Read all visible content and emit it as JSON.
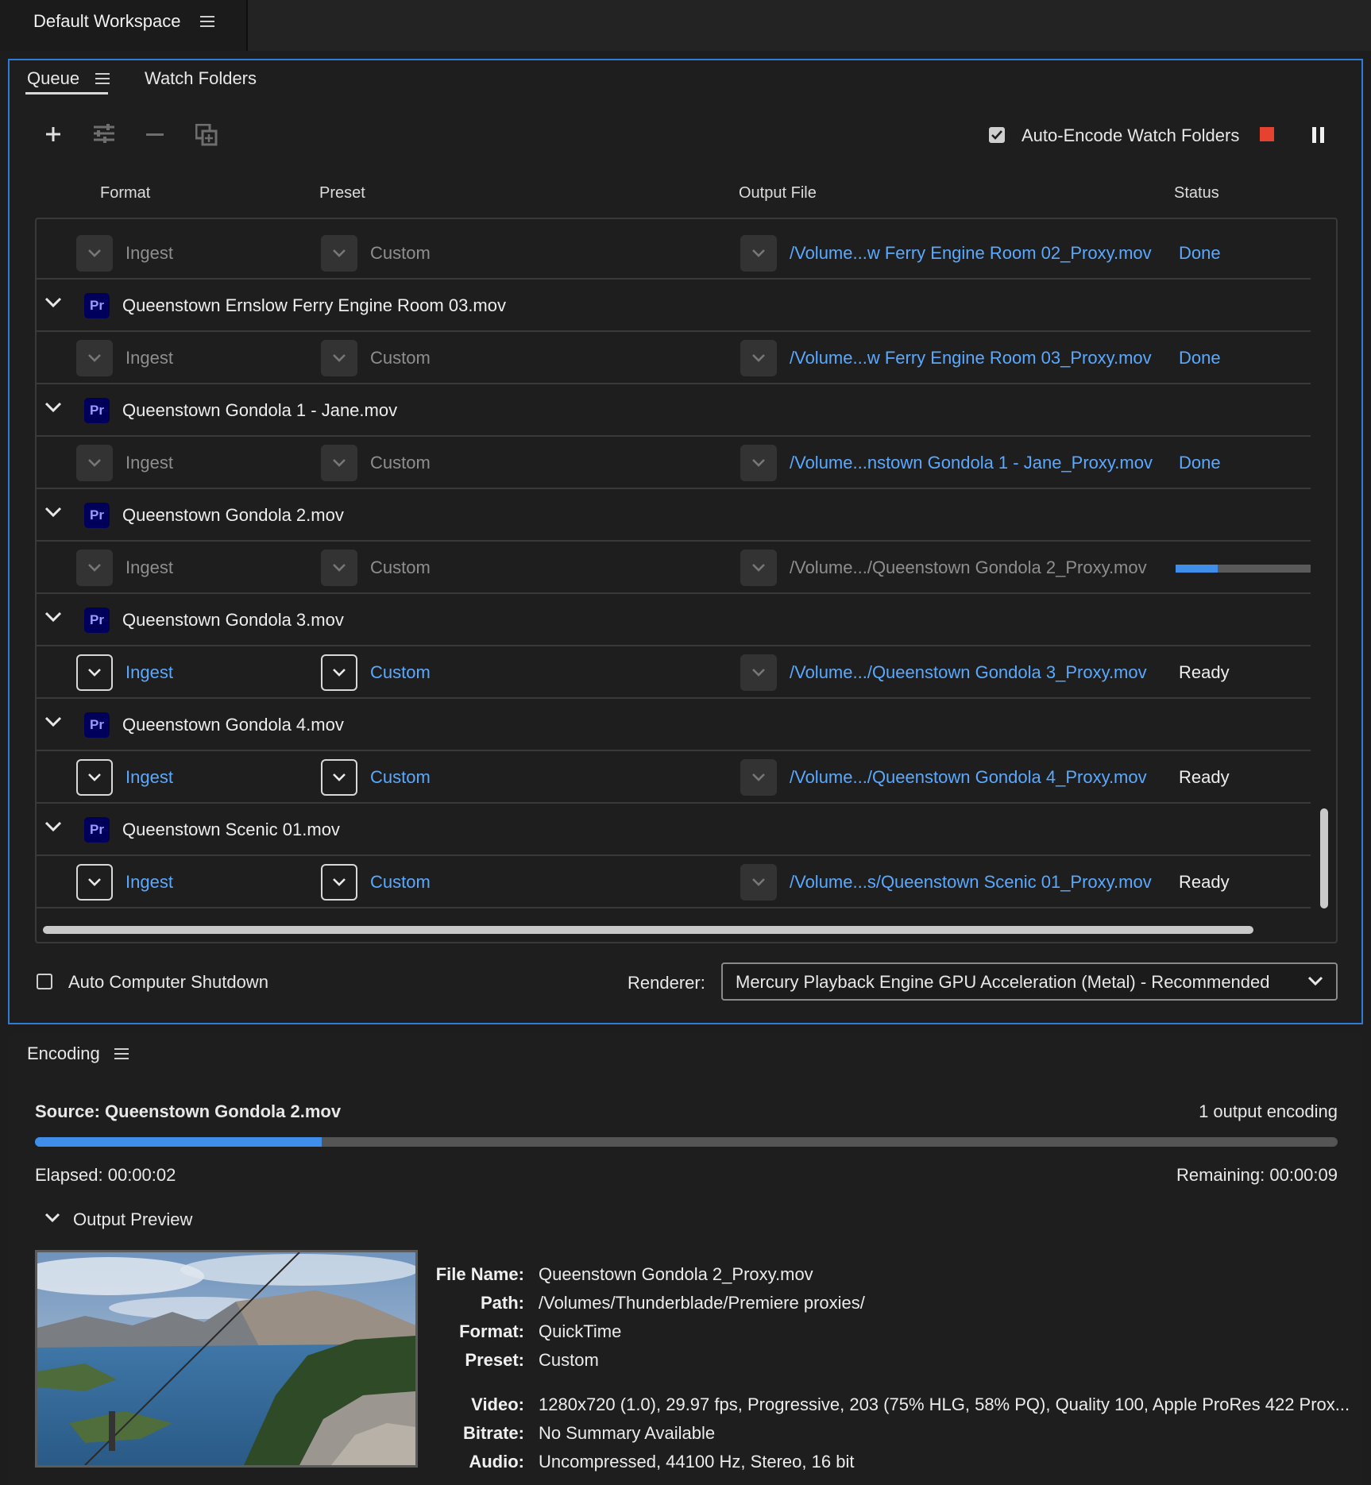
{
  "workspace": {
    "title": "Default Workspace"
  },
  "queue": {
    "tabs": [
      {
        "label": "Queue"
      },
      {
        "label": "Watch Folders"
      }
    ],
    "auto_encode": {
      "label": "Auto-Encode Watch Folders",
      "checked": true
    },
    "columns": {
      "format": "Format",
      "preset": "Preset",
      "output": "Output File",
      "status": "Status"
    },
    "rows": [
      {
        "kind": "output",
        "format": "Ingest",
        "preset": "Custom",
        "output": "/Volume...w Ferry Engine Room 02_Proxy.mov",
        "status": "Done",
        "editable": false
      },
      {
        "kind": "source",
        "name": "Queenstown Ernslow Ferry Engine Room 03.mov",
        "badge": "Pr"
      },
      {
        "kind": "output",
        "format": "Ingest",
        "preset": "Custom",
        "output": "/Volume...w Ferry Engine Room 03_Proxy.mov",
        "status": "Done",
        "editable": false
      },
      {
        "kind": "source",
        "name": "Queenstown Gondola 1 - Jane.mov",
        "badge": "Pr"
      },
      {
        "kind": "output",
        "format": "Ingest",
        "preset": "Custom",
        "output": "/Volume...nstown Gondola 1 - Jane_Proxy.mov",
        "status": "Done",
        "editable": false
      },
      {
        "kind": "source",
        "name": "Queenstown Gondola 2.mov",
        "badge": "Pr"
      },
      {
        "kind": "output",
        "format": "Ingest",
        "preset": "Custom",
        "output": "/Volume.../Queenstown Gondola 2_Proxy.mov",
        "status": "",
        "progress": 0.31,
        "editable": false
      },
      {
        "kind": "source",
        "name": "Queenstown Gondola 3.mov",
        "badge": "Pr"
      },
      {
        "kind": "output",
        "format": "Ingest",
        "preset": "Custom",
        "output": "/Volume.../Queenstown Gondola 3_Proxy.mov",
        "status": "Ready",
        "editable": true
      },
      {
        "kind": "source",
        "name": "Queenstown Gondola 4.mov",
        "badge": "Pr"
      },
      {
        "kind": "output",
        "format": "Ingest",
        "preset": "Custom",
        "output": "/Volume.../Queenstown Gondola 4_Proxy.mov",
        "status": "Ready",
        "editable": true
      },
      {
        "kind": "source",
        "name": "Queenstown Scenic 01.mov",
        "badge": "Pr"
      },
      {
        "kind": "output",
        "format": "Ingest",
        "preset": "Custom",
        "output": "/Volume...s/Queenstown Scenic 01_Proxy.mov",
        "status": "Ready",
        "editable": true
      }
    ],
    "auto_shutdown": {
      "label": "Auto Computer Shutdown",
      "checked": false
    },
    "renderer": {
      "label": "Renderer:",
      "value": "Mercury Playback Engine GPU Acceleration (Metal) - Recommended"
    }
  },
  "encoding": {
    "title": "Encoding",
    "source": "Source: Queenstown Gondola 2.mov",
    "outputs": "1 output encoding",
    "progress": 0.22,
    "elapsed": "Elapsed: 00:00:02",
    "remaining": "Remaining: 00:00:09",
    "preview_label": "Output Preview",
    "details": [
      {
        "key": "File Name:",
        "value": "Queenstown Gondola 2_Proxy.mov"
      },
      {
        "key": "Path:",
        "value": "/Volumes/Thunderblade/Premiere proxies/"
      },
      {
        "key": "Format:",
        "value": "QuickTime"
      },
      {
        "key": "Preset:",
        "value": "Custom"
      },
      {
        "key": "Video:",
        "value": "1280x720 (1.0), 29.97 fps, Progressive, 203 (75% HLG, 58% PQ), Quality 100, Apple ProRes 422 Prox..."
      },
      {
        "key": "Bitrate:",
        "value": "No Summary Available"
      },
      {
        "key": "Audio:",
        "value": "Uncompressed, 44100 Hz, Stereo, 16 bit"
      }
    ]
  },
  "colors": {
    "accent": "#2e7cd6",
    "link": "#5aa9ff",
    "stop": "#e5432f",
    "progress": "#3e8eea",
    "pr_badge": "#00005b"
  }
}
